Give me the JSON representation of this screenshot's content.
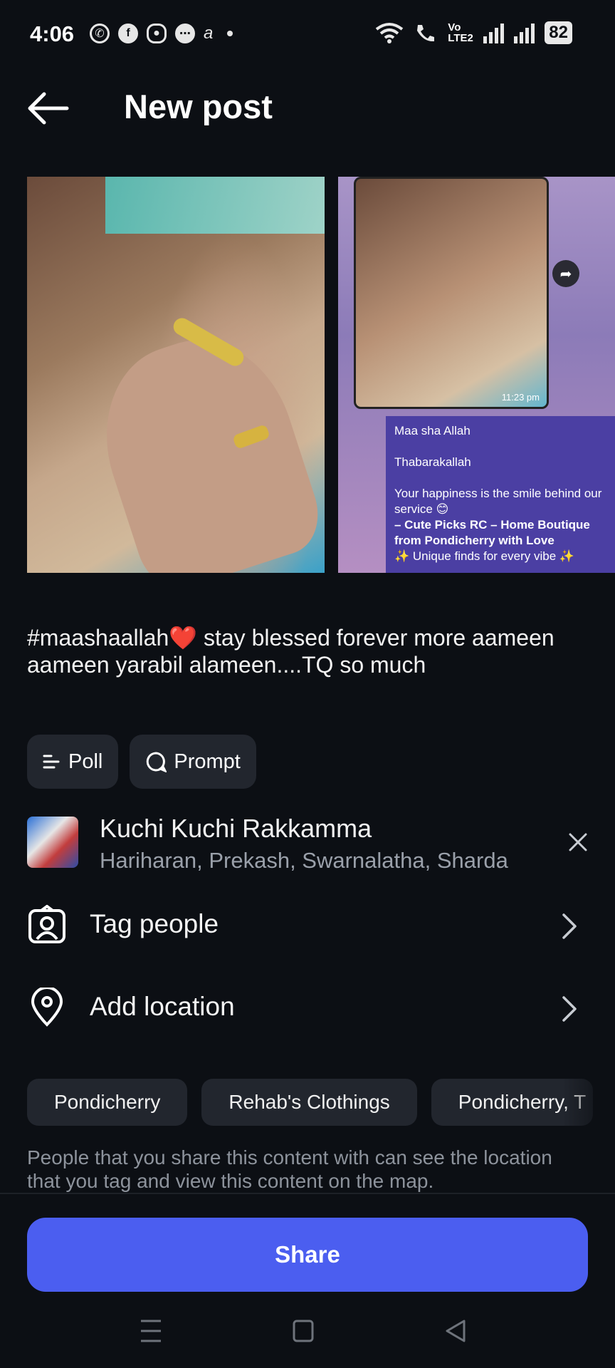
{
  "status_bar": {
    "time": "4:06",
    "network": "Vo LTE2",
    "battery": "82"
  },
  "header": {
    "title": "New post"
  },
  "media": {
    "second_image": {
      "timestamp": "11:23 pm",
      "message_lines": [
        "Maa sha Allah",
        "Thabarakallah",
        "Your happiness is the smile behind our service 😊",
        "– Cute Picks RC – Home Boutique from Pondicherry with Love",
        "✨ Unique finds for every vibe ✨"
      ]
    }
  },
  "caption": "#maashaallah❤️ stay blessed forever more aameen aameen yarabil alameen....TQ so much",
  "chips": {
    "poll": "Poll",
    "prompt": "Prompt"
  },
  "music": {
    "title": "Kuchi Kuchi Rakkamma",
    "artists": "Hariharan, Prekash, Swarnalatha, Sharda"
  },
  "rows": {
    "tag_people": "Tag people",
    "add_location": "Add location"
  },
  "location_suggestions": [
    "Pondicherry",
    "Rehab's Clothings",
    "Pondicherry, T"
  ],
  "location_note": "People that you share this content with can see the location that you tag and view this content on the map.",
  "share_button": "Share",
  "colors": {
    "background": "#0c0f14",
    "accent": "#4b5ef0",
    "chip": "#22262e",
    "muted_text": "#8d939c"
  }
}
